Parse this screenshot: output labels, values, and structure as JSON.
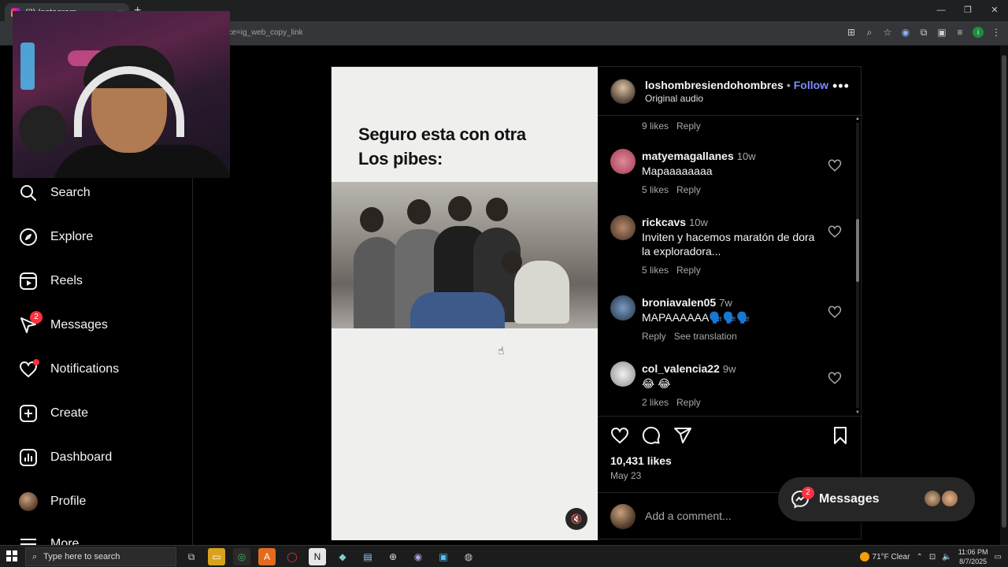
{
  "browser": {
    "tab_title": "(2) Instagram",
    "url_fragment": "rce=ig_web_copy_link"
  },
  "sidebar": {
    "items": [
      {
        "label": "Search",
        "icon": "search-icon"
      },
      {
        "label": "Explore",
        "icon": "compass-icon"
      },
      {
        "label": "Reels",
        "icon": "reels-icon"
      },
      {
        "label": "Messages",
        "icon": "messenger-icon",
        "badge": "2"
      },
      {
        "label": "Notifications",
        "icon": "heart-icon"
      },
      {
        "label": "Create",
        "icon": "plus-square-icon"
      },
      {
        "label": "Dashboard",
        "icon": "chart-icon"
      },
      {
        "label": "Profile",
        "icon": "avatar"
      },
      {
        "label": "More",
        "icon": "menu-icon"
      }
    ]
  },
  "post": {
    "media_text_line1": "Seguro esta con otra",
    "media_text_line2": "Los pibes:",
    "username": "loshombresiendohombres",
    "separator": "•",
    "follow_label": "Follow",
    "audio": "Original audio",
    "top_meta": {
      "likes": "9 likes",
      "reply": "Reply"
    },
    "comments": [
      {
        "user": "matyemagallanes",
        "ago": "10w",
        "text": "Mapaaaaaaaa",
        "likes": "5 likes",
        "reply": "Reply",
        "avatar_color": "#c2566a"
      },
      {
        "user": "rickcavs",
        "ago": "10w",
        "text": "Inviten y hacemos maratón de dora la exploradora...",
        "likes": "5 likes",
        "reply": "Reply",
        "avatar_color": "#6d4a3a"
      },
      {
        "user": "broniavalen05",
        "ago": "7w",
        "text": "MAPAAAAAA🗣️🗣️🗣️",
        "likes": "",
        "reply": "Reply",
        "extra": "See translation",
        "avatar_color": "#3b4f6b"
      },
      {
        "user": "col_valencia22",
        "ago": "9w",
        "text": "😂 😂",
        "likes": "2 likes",
        "reply": "Reply",
        "avatar_color": "#d8d8d8"
      }
    ],
    "likes_count": "10,431 likes",
    "date": "May 23",
    "comment_placeholder": "Add a comment..."
  },
  "messages_pill": {
    "label": "Messages",
    "badge": "2"
  },
  "taskbar": {
    "search_placeholder": "Type here to search",
    "weather": "71°F  Clear",
    "time": "11:06 PM",
    "date": "8/7/2025"
  }
}
